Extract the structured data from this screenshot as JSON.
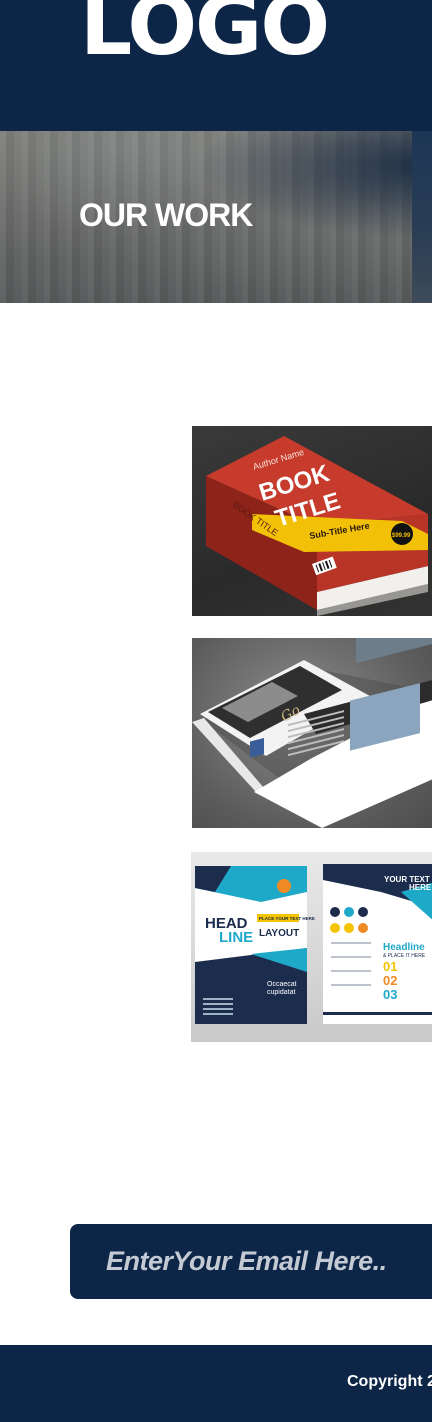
{
  "header": {
    "logo_text": "LOGO"
  },
  "hero": {
    "title": "OUR WORK"
  },
  "gallery": {
    "book": {
      "author": "Author Name",
      "title_line1": "BOOK",
      "title_line2": "TITLE",
      "subtitle": "Sub-Title Here",
      "price": "$99.99",
      "spine": "BOOK TITLE"
    },
    "brochure": {
      "logo_mark": "Go"
    },
    "flyer": {
      "headline_1": "HEAD",
      "headline_2": "LINE",
      "place_text": "PLACE YOUR TEXT HERE",
      "layout": "LAYOUT",
      "tagline_1": "Occaecat",
      "tagline_2": "cupidatat",
      "your_text_1": "YOUR TEXT",
      "your_text_2": "HERE",
      "headline_right": "Headline",
      "place_it": "& PLACE IT HERE",
      "num_1": "01",
      "num_2": "02",
      "num_3": "03"
    }
  },
  "newsletter": {
    "placeholder": "EnterYour Email Here.."
  },
  "footer": {
    "copyright": "Copyright 2"
  },
  "colors": {
    "navy": "#0d2547",
    "book_red": "#c43a2a",
    "book_band": "#f5c400",
    "flyer_cyan": "#1fa9c9",
    "flyer_navy": "#1b2c4d"
  }
}
